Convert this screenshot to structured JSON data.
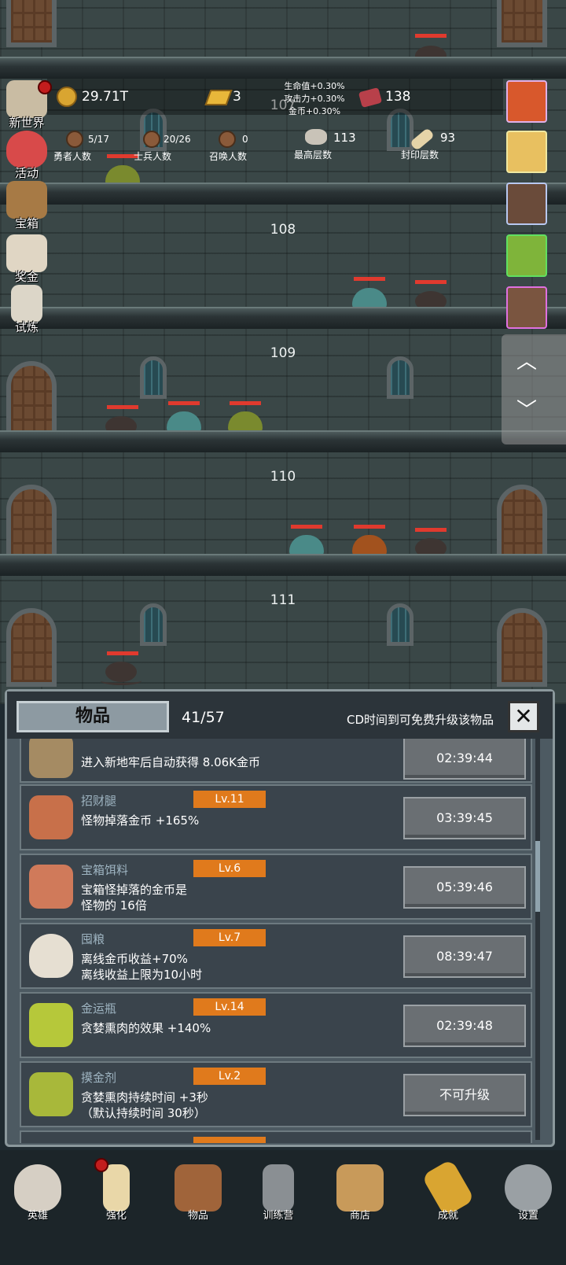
{
  "resources": {
    "gold": "29.71T",
    "bars": "3",
    "gems": "138",
    "bonus_lines": [
      "生命值+0.30%",
      "攻击力+0.30%",
      "金币+0.30%"
    ],
    "heroes": {
      "value": "5/17",
      "label": "勇者人数"
    },
    "soldiers": {
      "value": "20/26",
      "label": "士兵人数"
    },
    "summons": {
      "value": "0",
      "label": "召唤人数"
    },
    "max_floor": {
      "value": "113",
      "label": "最高层数"
    },
    "sealed_floor": {
      "value": "93",
      "label": "封印层数"
    }
  },
  "floors": [
    "107",
    "108",
    "109",
    "110",
    "111"
  ],
  "left_menu": [
    {
      "label": "新世界",
      "icon": "map-scroll-icon",
      "color": "#c9bca3"
    },
    {
      "label": "活动",
      "icon": "heart-icon",
      "color": "#d84a4a"
    },
    {
      "label": "宝箱",
      "icon": "treasure-chest-icon",
      "color": "#a77a45"
    },
    {
      "label": "奖金",
      "icon": "envelope-icon",
      "color": "#e0d6c4"
    },
    {
      "label": "试炼",
      "icon": "feather-icon",
      "color": "#dcd6c8"
    }
  ],
  "right_buffs": [
    {
      "icon": "apple-buff-icon",
      "color": "#d8582c"
    },
    {
      "icon": "candle-buff-icon",
      "color": "#e8c060"
    },
    {
      "icon": "chest-buff-icon",
      "color": "#6a4b3a"
    },
    {
      "icon": "slime-buff-icon",
      "color": "#7fb43a"
    },
    {
      "icon": "hero-buff-icon",
      "color": "#7a5540"
    }
  ],
  "panel": {
    "tab": "物品",
    "count": "41/57",
    "hint": "CD时间到可免费升级该物品",
    "close": "✕",
    "items": [
      {
        "name": "",
        "level": "",
        "desc": "进入新地牢后自动获得 8.06K金币",
        "button": "02:39:44",
        "icon": "bag-icon",
        "color": "#a58b63"
      },
      {
        "name": "招财腿",
        "level": "Lv.11",
        "desc": "怪物掉落金币 +165%",
        "button": "03:39:45",
        "icon": "meat-leg-icon",
        "color": "#c8704a"
      },
      {
        "name": "宝箱饵料",
        "level": "Lv.6",
        "desc": "宝箱怪掉落的金币是\n怪物的 16倍",
        "button": "05:39:46",
        "icon": "steak-icon",
        "color": "#d07a5a"
      },
      {
        "name": "囤粮",
        "level": "Lv.7",
        "desc": "离线金币收益+70%\n离线收益上限为10小时",
        "button": "08:39:47",
        "icon": "rice-bowl-icon",
        "color": "#e6dfd2"
      },
      {
        "name": "金运瓶",
        "level": "Lv.14",
        "desc": "贪婪熏肉的效果 +140%",
        "button": "02:39:48",
        "icon": "potion-bottle-icon",
        "color": "#b6c83a"
      },
      {
        "name": "摸金剂",
        "level": "Lv.2",
        "desc": "贪婪熏肉持续时间 +3秒\n（默认持续时间 30秒）",
        "button": "不可升级",
        "icon": "potion-jar-icon",
        "color": "#a8b83a"
      }
    ]
  },
  "bottom_nav": [
    {
      "label": "英雄",
      "icon": "skull-icon",
      "color": "#d6cfc4"
    },
    {
      "label": "强化",
      "icon": "candle-icon",
      "color": "#e9d7a8"
    },
    {
      "label": "物品",
      "icon": "book-icon",
      "color": "#a0643a"
    },
    {
      "label": "训练营",
      "icon": "lantern-icon",
      "color": "#8a8f93"
    },
    {
      "label": "商店",
      "icon": "beer-mug-icon",
      "color": "#c89a5a"
    },
    {
      "label": "成就",
      "icon": "key-icon",
      "color": "#d9a531"
    },
    {
      "label": "设置",
      "icon": "gear-icon",
      "color": "#9aa0a4"
    }
  ]
}
